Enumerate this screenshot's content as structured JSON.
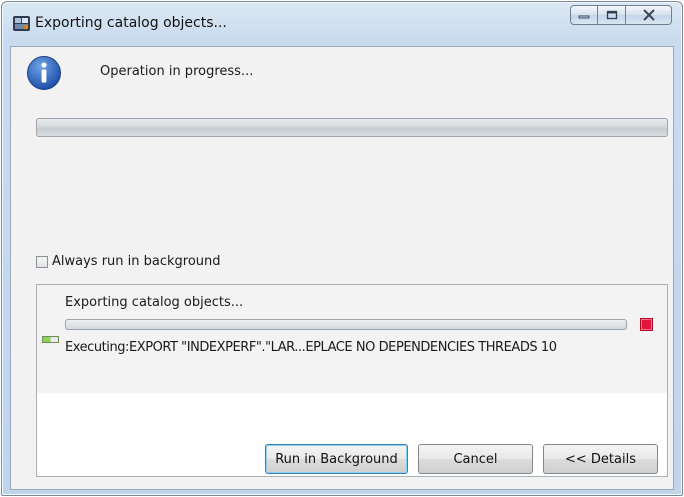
{
  "window": {
    "title": "Exporting catalog objects...",
    "controls": {
      "minimize_icon": "minimize-icon",
      "maximize_icon": "maximize-icon",
      "close_icon": "close-icon"
    }
  },
  "main": {
    "status_icon": "info-icon",
    "status_text": "Operation in progress...",
    "progress_fraction": 0
  },
  "background_option": {
    "label": "Always run in background",
    "checked": false
  },
  "task": {
    "name": "Exporting catalog objects...",
    "progress_fraction": 0,
    "stop_icon": "stop-icon",
    "status_icon": "executing-icon",
    "status_text": "Executing:EXPORT \"INDEXPERF\".\"LAR...EPLACE NO DEPENDENCIES THREADS 10"
  },
  "buttons": {
    "run_in_background": "Run in Background",
    "cancel": "Cancel",
    "details": "<< Details"
  },
  "colors": {
    "title_gradient_top": "#dbe7f4",
    "stop_red": "#e0163c",
    "default_button_border": "#3c7fb1"
  }
}
